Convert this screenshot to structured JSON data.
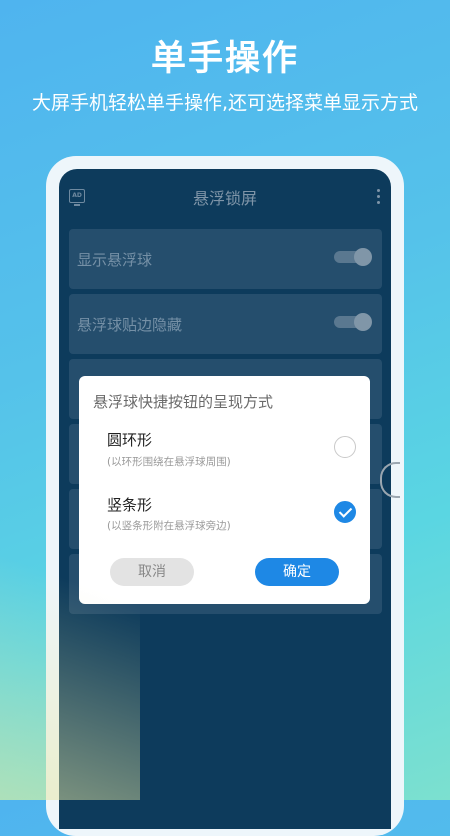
{
  "hero": {
    "title": "单手操作",
    "subtitle": "大屏手机轻松单手操作,还可选择菜单显示方式"
  },
  "app": {
    "title": "悬浮锁屏",
    "ad_icon_text": "AD",
    "settings": [
      {
        "label": "显示悬浮球",
        "enabled": true
      },
      {
        "label": "悬浮球贴边隐藏",
        "enabled": true
      }
    ]
  },
  "dialog": {
    "title": "悬浮球快捷按钮的呈现方式",
    "options": [
      {
        "title": "圆环形",
        "desc": "(以环形围绕在悬浮球周围)",
        "selected": false
      },
      {
        "title": "竖条形",
        "desc": "(以竖条形附在悬浮球旁边)",
        "selected": true
      }
    ],
    "cancel_label": "取消",
    "ok_label": "确定"
  },
  "colors": {
    "accent": "#1e88e5",
    "screen_bg": "#0d3b5c"
  }
}
